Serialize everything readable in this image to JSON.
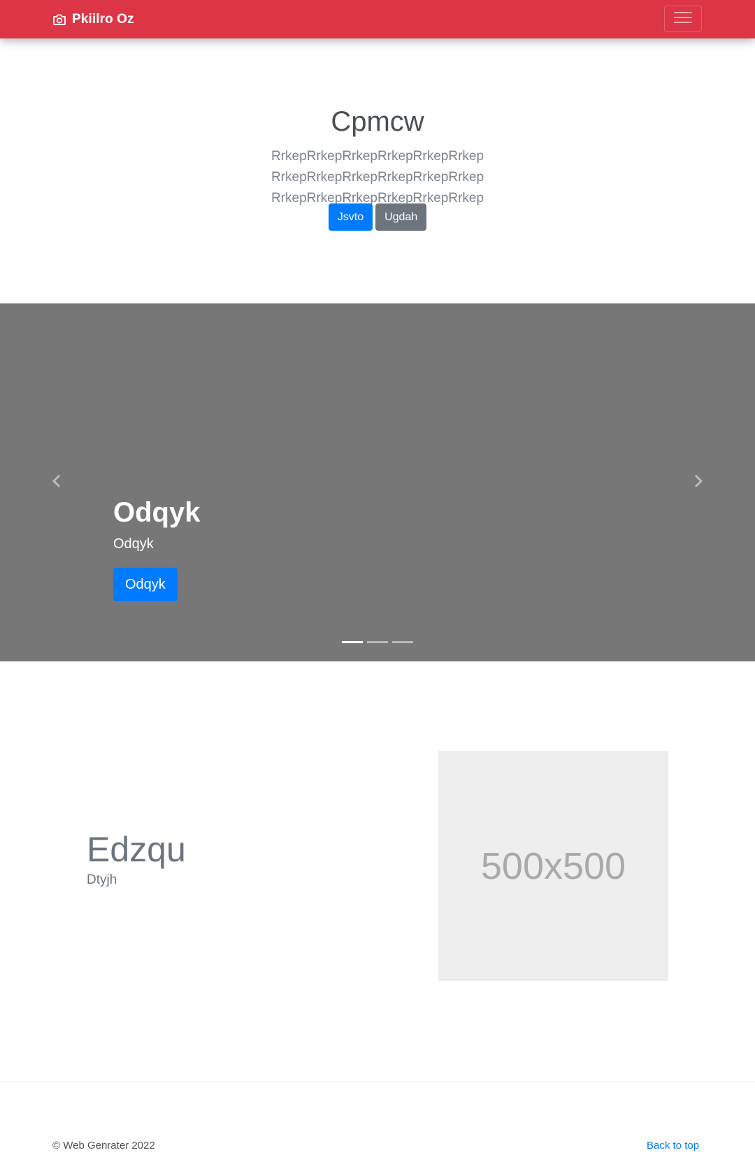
{
  "navbar": {
    "brand": "Pkiilro Oz",
    "brand_icon": "camera-icon",
    "toggler_icon": "hamburger-menu-icon",
    "background": "#dc3545"
  },
  "hero": {
    "title": "Cpmcw",
    "lead": "RrkepRrkepRrkepRrkepRrkepRrkep RrkepRrkepRrkepRrkepRrkepRrkep RrkepRrkepRrkepRrkepRrkepRrkep",
    "primary_button": "Jsvto",
    "secondary_button": "Ugdah"
  },
  "carousel": {
    "caption_title": "Odqyk",
    "caption_text": "Odqyk",
    "caption_button": "Odqyk",
    "prev_icon": "chevron-left-icon",
    "next_icon": "chevron-right-icon",
    "slide_count": 3,
    "active_slide": 1,
    "background": "#777777"
  },
  "featurette": {
    "heading": "Edzqu",
    "subtext": "Dtyjh",
    "placeholder_label": "500x500"
  },
  "footer": {
    "copyright": "© Web Genrater 2022",
    "back_to_top": "Back to top"
  },
  "colors": {
    "primary": "#007bff",
    "secondary": "#6c757d",
    "danger": "#dc3545"
  }
}
